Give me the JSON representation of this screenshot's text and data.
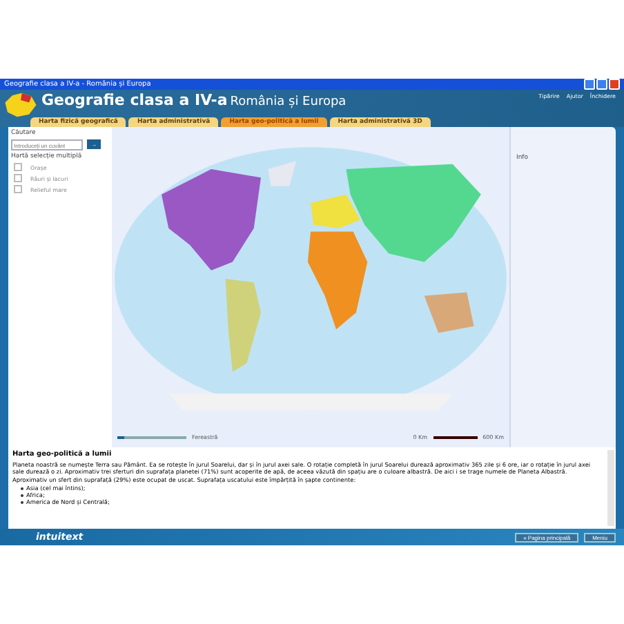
{
  "window": {
    "title": "Geografie clasa a IV-a - România și Europa"
  },
  "header": {
    "title": "Geografie clasa a IV-a",
    "subtitle": "România și Europa",
    "links": [
      "Tipărire",
      "Ajutor",
      "Închidere"
    ]
  },
  "tabs": [
    {
      "label": "Harta fizică geografică",
      "selected": false
    },
    {
      "label": "Harta administrativă",
      "selected": false
    },
    {
      "label": "Harta geo-politică a lumii",
      "selected": true
    },
    {
      "label": "Harta administrativă 3D",
      "selected": false
    }
  ],
  "sidebar": {
    "search_label": "Căutare",
    "search": {
      "placeholder": "Introduceți un cuvânt"
    },
    "search_button": "→",
    "section": "Hartă selecție multiplă",
    "options": [
      {
        "label": "Orașe",
        "checked": false
      },
      {
        "label": "Râuri și lacuri",
        "checked": false
      },
      {
        "label": "Relieful mare",
        "checked": false
      }
    ]
  },
  "map": {
    "level": 0.1,
    "zoom_label": "Fereastră",
    "scale_start": "0 Km",
    "scale_end": "600 Km"
  },
  "info": {
    "label": "Info"
  },
  "text_panel": {
    "title": "Harta geo-politică a lumii",
    "paragraphs": [
      "Planeta noastră se numește Terra sau Pământ. Ea se rotește în jurul Soarelui, dar și în jurul axei sale. O rotație completă în jurul Soarelui durează aproximativ 365 zile și 6 ore, iar o rotație în jurul axei sale durează o zi. Aproximativ trei sferturi din suprafața planetei (71%) sunt acoperite de apă, de aceea văzută din spațiu are o culoare albastră. De aici i se trage numele de Planeta Albastră.",
      "Aproximativ un sfert din suprafață (29%) este ocupat de uscat. Suprafața uscatului este împărțită în șapte continente:"
    ],
    "bullets": [
      "Asia (cel mai întins);",
      "Africa;",
      "America de Nord și Centrală;"
    ]
  },
  "footer": {
    "brand": "intuitext",
    "buttons": [
      "« Pagina principală",
      "Meniu"
    ]
  }
}
